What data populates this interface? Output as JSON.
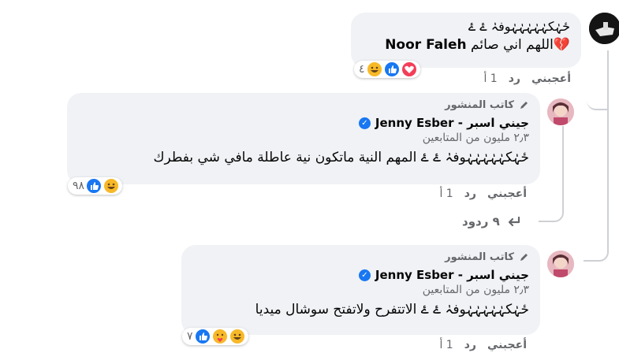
{
  "comment1": {
    "text_line1": "ځہٰکہٰہٰہٰہٰہٰوفہٰ ۓ ۓ",
    "text_line2": "💔اللهم اني صائم",
    "tagged_name": "Noor Faleh",
    "reactions_count": "٤",
    "actions": {
      "like": "أعجبني",
      "reply": "رد",
      "time": "1 أ"
    }
  },
  "reply1": {
    "author_badge": "كاتب المنشور",
    "author_name": "جيني اسبر - Jenny Esber",
    "followers": "٢٫٣ مليون من المتابعين",
    "text": "ځہٰکہٰہٰہٰہٰہٰوفہٰ ۓ ۓ المهم النية ماتكون نية عاطلة مافي شي بفطرك",
    "reactions_count": "٩٨",
    "actions": {
      "like": "أعجبني",
      "reply": "رد",
      "time": "1 أ"
    }
  },
  "more_replies": {
    "label": "٩ ردود"
  },
  "reply2": {
    "author_badge": "كاتب المنشور",
    "author_name": "جيني اسبر - Jenny Esber",
    "followers": "٢٫٣ مليون من المتابعين",
    "text": "ځہٰکہٰہٰہٰہٰہٰوفہٰ ۓ ۓ الاتتفرح ولاتفتح سوشال ميديا",
    "reactions_count": "٧",
    "actions": {
      "like": "أعجبني",
      "reply": "رد",
      "time": "1 أ"
    }
  },
  "colors": {
    "bubble": "#f0f2f5",
    "muted": "#65676b",
    "verified": "#1877f2",
    "thread_line": "#ced0d4"
  }
}
